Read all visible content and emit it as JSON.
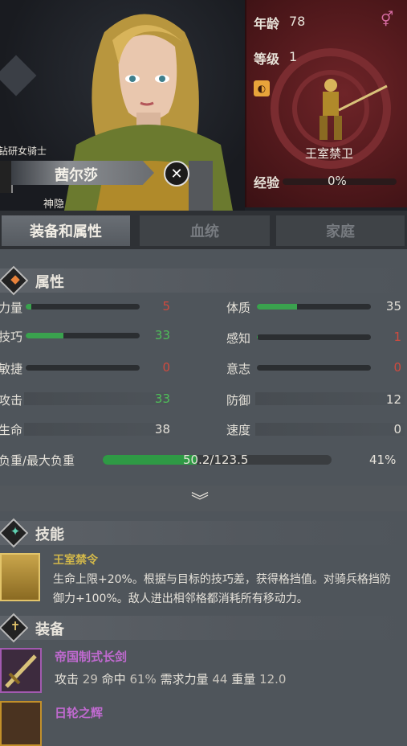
{
  "hero": {
    "class_title": "钻研女骑士",
    "name": "茜尔莎",
    "subtitle": "神隐",
    "age_label": "年龄",
    "age_value": "78",
    "level_label": "等级",
    "level_value": "1",
    "unit_label": "王室禁卫",
    "xp_label": "经验",
    "xp_value": "0%",
    "xp_fraction": 0.0,
    "colors": {
      "panel": "#5a1a1e",
      "gender": "#d46aa0"
    }
  },
  "tabs": [
    {
      "label": "装备和属性",
      "active": true
    },
    {
      "label": "血统",
      "active": false
    },
    {
      "label": "家庭",
      "active": false
    }
  ],
  "attributes_section": {
    "title": "属性",
    "left": [
      {
        "label": "力量",
        "value": "5",
        "fill": 0.05,
        "color": "red"
      },
      {
        "label": "技巧",
        "value": "33",
        "fill": 0.33,
        "color": "green"
      },
      {
        "label": "敏捷",
        "value": "0",
        "fill": 0.0,
        "color": "red"
      }
    ],
    "right": [
      {
        "label": "体质",
        "value": "35",
        "fill": 0.35,
        "color": "green"
      },
      {
        "label": "感知",
        "value": "1",
        "fill": 0.01,
        "color": "red"
      },
      {
        "label": "意志",
        "value": "0",
        "fill": 0.0,
        "color": "red"
      }
    ],
    "derived_left": [
      {
        "label": "攻击",
        "value": "33",
        "color": "green"
      },
      {
        "label": "生命",
        "value": "38",
        "color": "white"
      }
    ],
    "derived_right": [
      {
        "label": "防御",
        "value": "12",
        "color": "white"
      },
      {
        "label": "速度",
        "value": "0",
        "color": "white"
      }
    ],
    "load_label": "负重/最大负重",
    "load_value": "50.2/123.5",
    "load_percent": "41%",
    "load_fraction": 0.41
  },
  "skills_section": {
    "title": "技能",
    "skill_name": "王室禁令",
    "skill_desc_1": "生命上限+20%。根据与目标的技巧差，获得格挡值。对骑兵格挡防",
    "skill_desc_2": "御力+100%。敌人进出相邻格都消耗所有移动力。"
  },
  "equipment_section": {
    "title": "装备",
    "items": [
      {
        "name": "帝国制式长剑",
        "atk_label": "攻击",
        "atk": "29",
        "hit_label": "命中",
        "hit": "61%",
        "str_label": "需求力量",
        "str": "44",
        "weight_label": "重量",
        "weight": "12.0"
      },
      {
        "name": "日轮之辉"
      }
    ]
  },
  "icons": [
    "rank-icon",
    "gender-female-icon",
    "class-badge-icon",
    "close-icon",
    "attributes-icon",
    "skills-icon",
    "equipment-icon",
    "chevron-double-down-icon",
    "skill-icon",
    "sword-icon",
    "armor-icon"
  ]
}
